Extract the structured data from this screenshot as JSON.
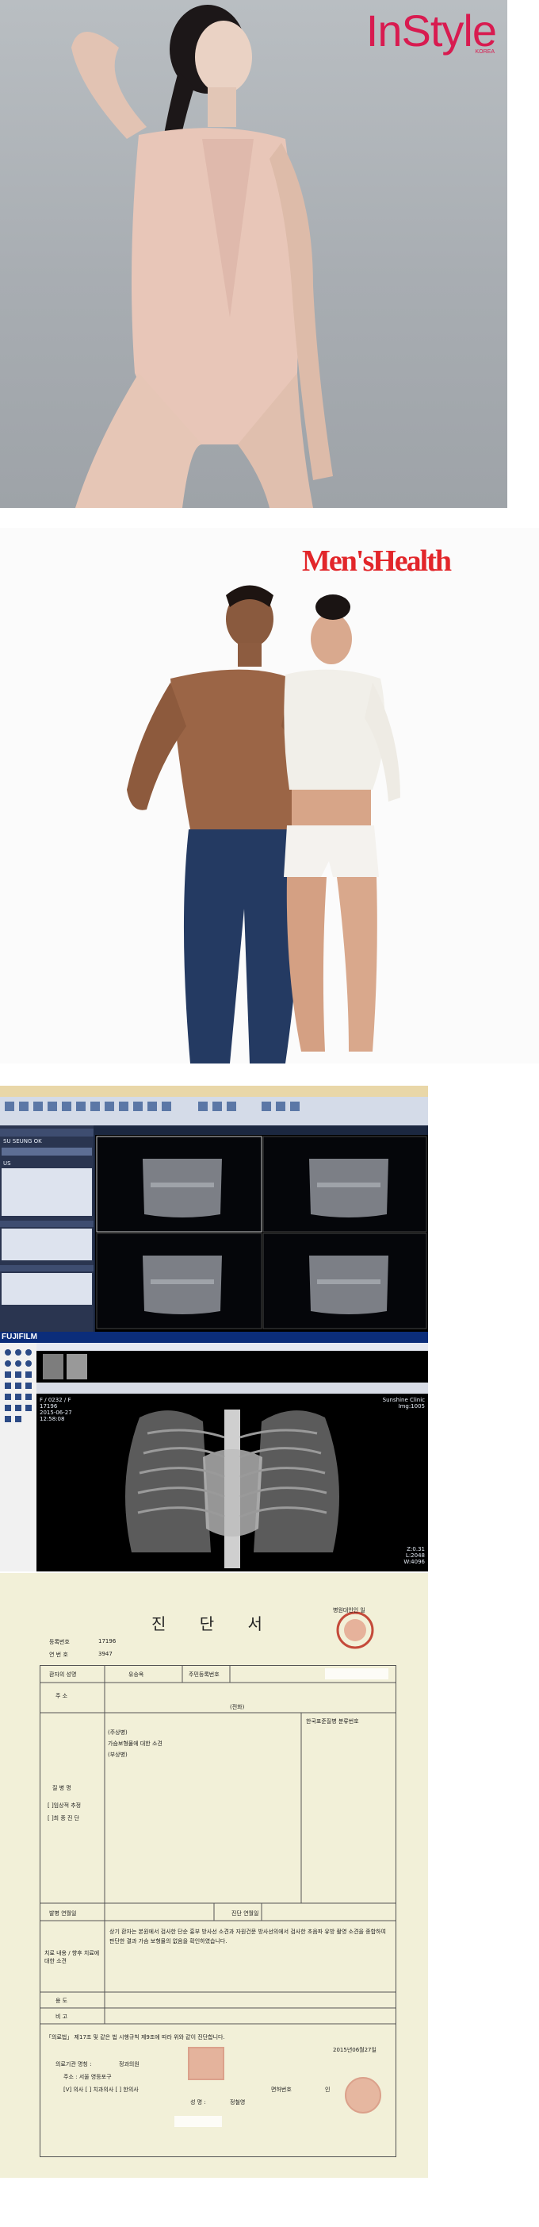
{
  "panel1": {
    "brand": "InStyle",
    "brand_sub": "KOREA",
    "brand_color": "#d81b50"
  },
  "panel2": {
    "brand": "Men'sHealth",
    "brand_color": "#e2262a"
  },
  "ultrasound": {
    "menu": [
      "SU SEUNG OK",
      "US"
    ],
    "patient_name": "SU SEUNG OK",
    "study": "US"
  },
  "xray": {
    "logo": "FUJIFILM",
    "study_date": "2015.06.27",
    "overlay_left": [
      "F / 0232 / F",
      "17196",
      "2015-06-27",
      "12:58:08"
    ],
    "overlay_right": [
      "Sunshine Clinic",
      "Img:1005"
    ],
    "overlay_bottom": [
      "Z:0.31",
      "L:2048",
      "W:4096"
    ]
  },
  "document": {
    "title": "진 단 서",
    "reg_label": "등록번호",
    "reg_no": "17196",
    "serial_label": "연 번 호",
    "serial_no": "3947",
    "stamp_top": "병원대인인 일",
    "name_label": "환자의 성명",
    "name_value": "유승옥",
    "rrn_label": "주민등록번호",
    "address_label": "주 소",
    "phone_label": "(전화)",
    "code_label": "한국표준질병 분류번호",
    "diagnosis_main": "(주상병)",
    "diagnosis_detail": "가슴보형물에 대한 소견",
    "diagnosis_sub": "(부상병)",
    "disease_label": "질 병 명",
    "clinical_label": "[ ]임상적 추정",
    "final_label": "[ ]최 종 진 단",
    "onset_label": "발병 연월일",
    "diag_date_label": "진단 연월일",
    "treatment_label": "치료 내용 / 향후 치료에 대한 소견",
    "opinion": "상기 환자는 본원에서 검사한 단순 흉부 방사선 소견과 자원건문 방사선의에서 검사한 초음파 유방 촬영 소견을 종합하여 판단한 결과 가슴 보형물의 없음을 확인하였습니다.",
    "use_label": "용 도",
    "remarks_label": "비 고",
    "law_text": "「의료법」 제17조 및 같은 법 시행규칙 제9조에 따라 위와 같이 진단합니다.",
    "date": "2015년06월27일",
    "institution_label": "의료기관 명칭 :",
    "institution_name": "정과의원",
    "address_line": "주소 : 서울 영등포구",
    "doctor_type": "[V] 의사   [  ] 치과의사 [  ] 한의사",
    "license_label": "면허번호",
    "doctor_label": "성 명 :",
    "doctor_name": "정철영",
    "stamp_bottom": "인"
  }
}
